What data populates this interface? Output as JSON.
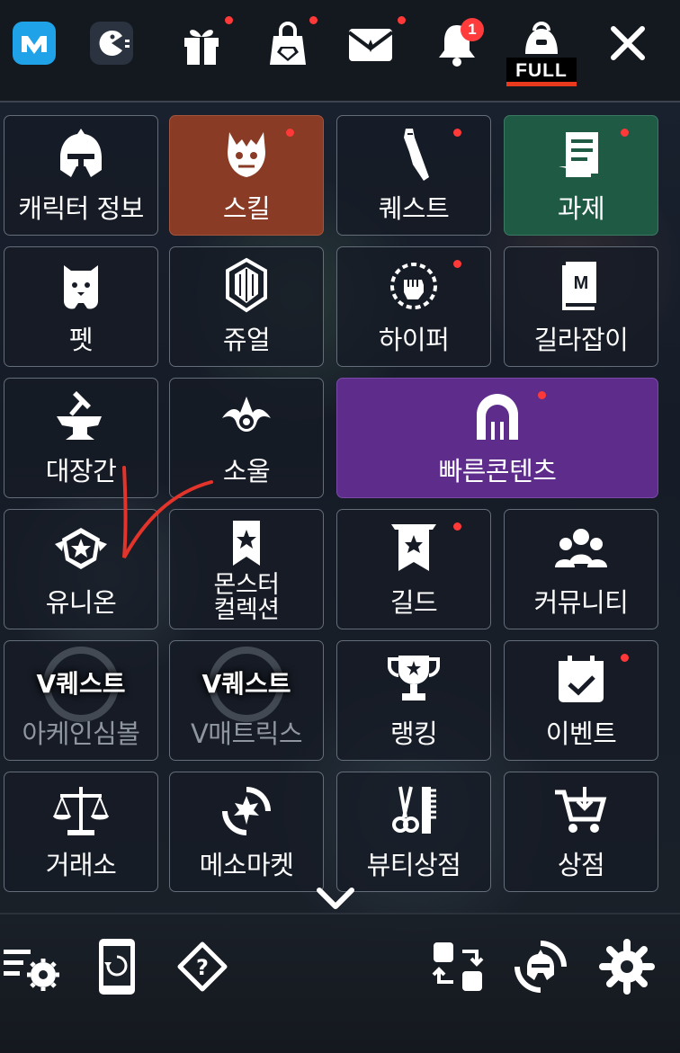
{
  "top_bar": {
    "notification_count": "1",
    "inventory_status": "FULL",
    "icons": [
      "maplestory-app-icon",
      "pacman-icon",
      "gift-icon",
      "cash-shop-icon",
      "mail-icon",
      "bell-icon",
      "inventory-bag-icon",
      "close-icon"
    ]
  },
  "menu": {
    "row1": [
      "캐릭터 정보",
      "스킬",
      "퀘스트",
      "과제"
    ],
    "row2": [
      "펫",
      "쥬얼",
      "하이퍼",
      "길라잡이"
    ],
    "row3": [
      "대장간",
      "소울",
      "빠른콘텐츠"
    ],
    "row4": [
      "유니온",
      "몬스터\n컬렉션",
      "길드",
      "커뮤니티"
    ],
    "row5": {
      "vquest_badge": "V퀘스트",
      "items": [
        "아케인심볼",
        "V매트릭스",
        "랭킹",
        "이벤트"
      ]
    },
    "row6": [
      "거래소",
      "메소마켓",
      "뷰티상점",
      "상점"
    ]
  },
  "bottom_bar": {
    "icons": [
      "menu-settings-icon",
      "phone-rotate-icon",
      "help-icon",
      "swap-icon",
      "character-swap-icon",
      "gear-icon"
    ]
  },
  "colors": {
    "skill_tile": "#8a3b25",
    "task_tile": "#1f5a45",
    "quick_content_tile": "#5e2d8c",
    "red_dot": "#ff3838"
  }
}
